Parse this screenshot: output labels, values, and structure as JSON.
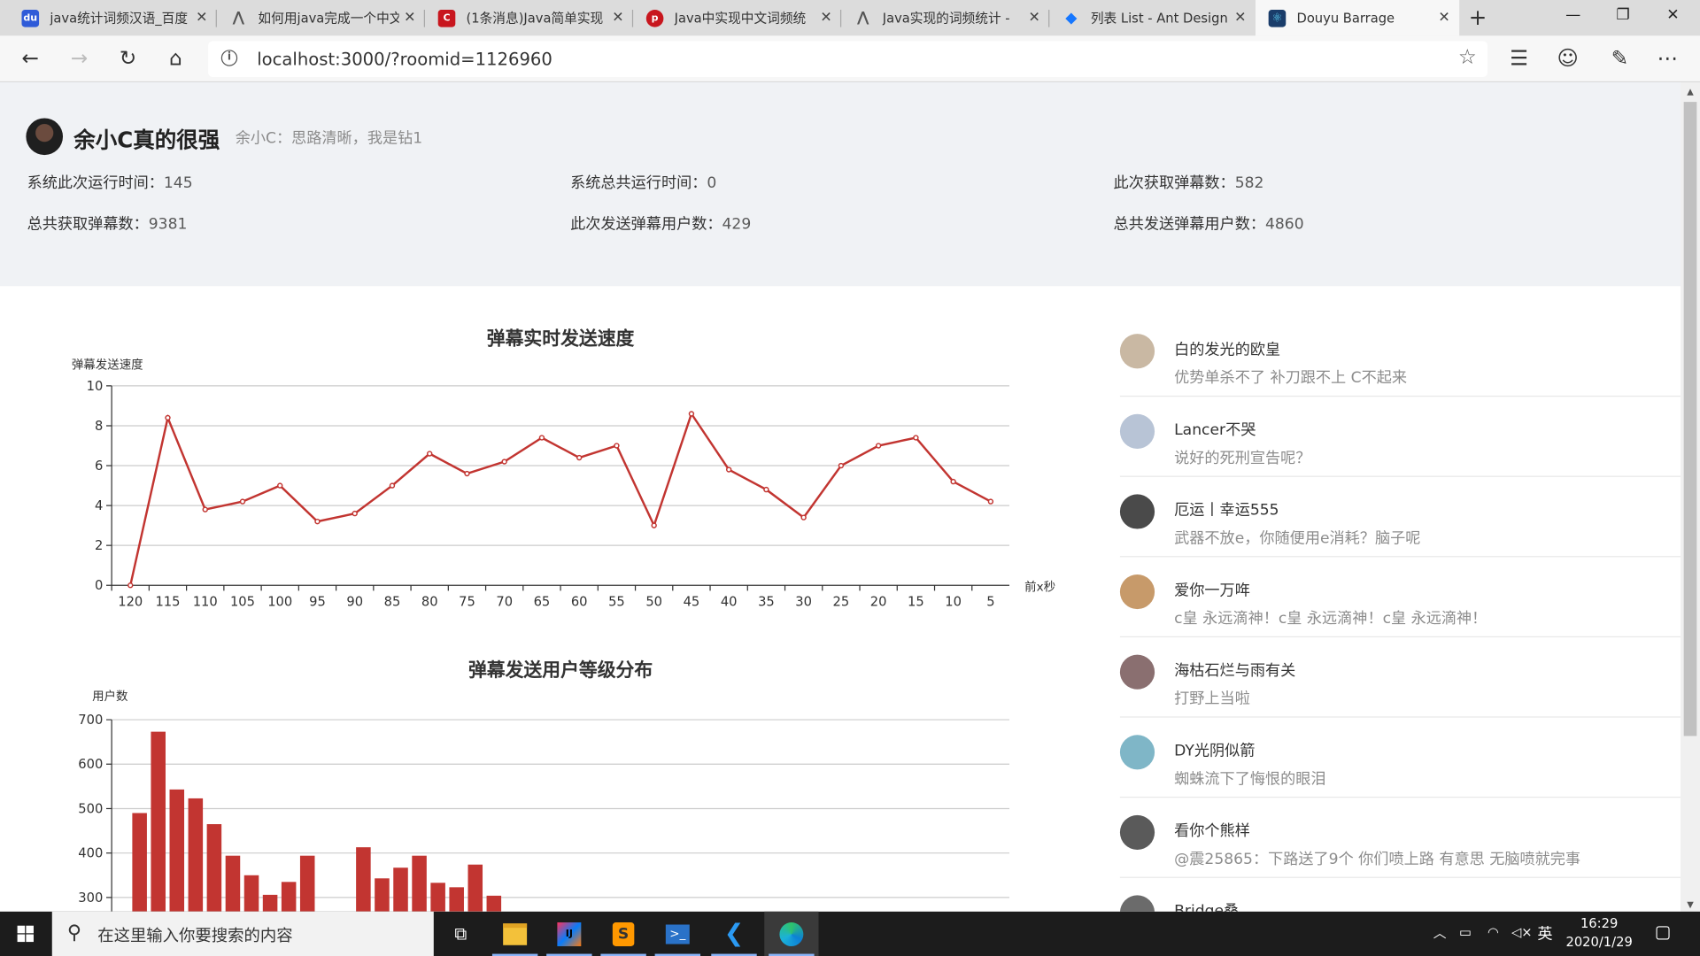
{
  "browser": {
    "tabs": [
      {
        "title": "java统计词频汉语_百度",
        "icon": "baidu-icon",
        "color": "#2f5bd8"
      },
      {
        "title": "如何用java完成一个中文",
        "icon": "zhihu-icon",
        "color": "#555555"
      },
      {
        "title": "(1条消息)Java简单实现",
        "icon": "csdn-icon",
        "color": "#c8161e"
      },
      {
        "title": "Java中实现中文词频统",
        "icon": "php-icon",
        "color": "#c8161e"
      },
      {
        "title": "Java实现的词频统计 - ",
        "icon": "zhihu-icon",
        "color": "#555555"
      },
      {
        "title": "列表 List - Ant Design",
        "icon": "antd-icon",
        "color": "#1677ff"
      },
      {
        "title": "Douyu Barrage",
        "icon": "react-icon",
        "color": "#1a3d6a"
      }
    ],
    "url": "localhost:3000/?roomid=1126960"
  },
  "header": {
    "streamer_name": "余小C真的很强",
    "signature": "余小C：思路清晰，我是钻1",
    "stats": [
      {
        "label": "系统此次运行时间：",
        "value": "145"
      },
      {
        "label": "系统总共运行时间：",
        "value": "0"
      },
      {
        "label": "此次获取弹幕数：",
        "value": "582"
      },
      {
        "label": "总共获取弹幕数：",
        "value": "9381"
      },
      {
        "label": "此次发送弹幕用户数：",
        "value": "429"
      },
      {
        "label": "总共发送弹幕用户数：",
        "value": "4860"
      }
    ]
  },
  "chart_data": [
    {
      "type": "line",
      "title": "弹幕实时发送速度",
      "ylabel": "弹幕发送速度",
      "xlabel": "前x秒",
      "ylim": [
        0,
        10
      ],
      "yticks": [
        0,
        2,
        4,
        6,
        8,
        10
      ],
      "grid": true,
      "color": "#c23531",
      "categories": [
        "120",
        "115",
        "110",
        "105",
        "100",
        "95",
        "90",
        "85",
        "80",
        "75",
        "70",
        "65",
        "60",
        "55",
        "50",
        "45",
        "40",
        "35",
        "30",
        "25",
        "20",
        "15",
        "10",
        "5"
      ],
      "values": [
        0,
        8.4,
        3.8,
        4.2,
        5.0,
        3.2,
        3.6,
        5.0,
        6.6,
        5.6,
        6.2,
        7.4,
        6.4,
        7.0,
        3.0,
        8.6,
        5.8,
        4.8,
        3.4,
        6.0,
        7.0,
        7.4,
        5.2,
        4.2
      ]
    },
    {
      "type": "bar",
      "title": "弹幕发送用户等级分布",
      "ylabel": "用户数",
      "ylim": [
        0,
        700
      ],
      "yticks_visible": [
        300,
        400,
        500,
        600,
        700
      ],
      "grid": true,
      "color": "#c23531",
      "values": [
        490,
        673,
        543,
        523,
        465,
        394,
        350,
        306,
        335,
        394,
        0,
        0,
        413,
        343,
        367,
        394,
        333,
        323,
        374,
        304
      ]
    }
  ],
  "barrage": [
    {
      "user": "白的发光的欧皇",
      "message": "优势单杀不了 补刀跟不上 C不起来",
      "icon": "user-avatar-icon",
      "color": "#c9b8a3"
    },
    {
      "user": "Lancer不哭",
      "message": "说好的死刑宣告呢？",
      "icon": "user-avatar-icon",
      "color": "#b8c4d6"
    },
    {
      "user": "厄运丨幸运555",
      "message": "武器不放e，你随便用e消耗？脑子呢",
      "icon": "user-avatar-icon",
      "color": "#4a4a4a"
    },
    {
      "user": "爱你一万哖",
      "message": "c皇 永远滴神！c皇 永远滴神！c皇 永远滴神！",
      "icon": "user-avatar-icon",
      "color": "#c79a6a"
    },
    {
      "user": "海枯石烂与雨有关",
      "message": "打野上当啦",
      "icon": "user-avatar-icon",
      "color": "#8a6f70"
    },
    {
      "user": "DY光阴似箭",
      "message": "蜘蛛流下了悔恨的眼泪",
      "icon": "user-avatar-icon",
      "color": "#7fb6c7"
    },
    {
      "user": "看你个熊样",
      "message": "@震25865：下路送了9个 你们喷上路 有意思 无脑喷就完事",
      "icon": "user-avatar-icon",
      "color": "#5a5a5a"
    },
    {
      "user": "Bridge桑",
      "message": "",
      "icon": "user-avatar-icon",
      "color": "#6b6b6b"
    }
  ],
  "taskbar": {
    "search_placeholder": "在这里输入你要搜索的内容",
    "ime": "英",
    "time": "16:29",
    "date": "2020/1/29"
  }
}
